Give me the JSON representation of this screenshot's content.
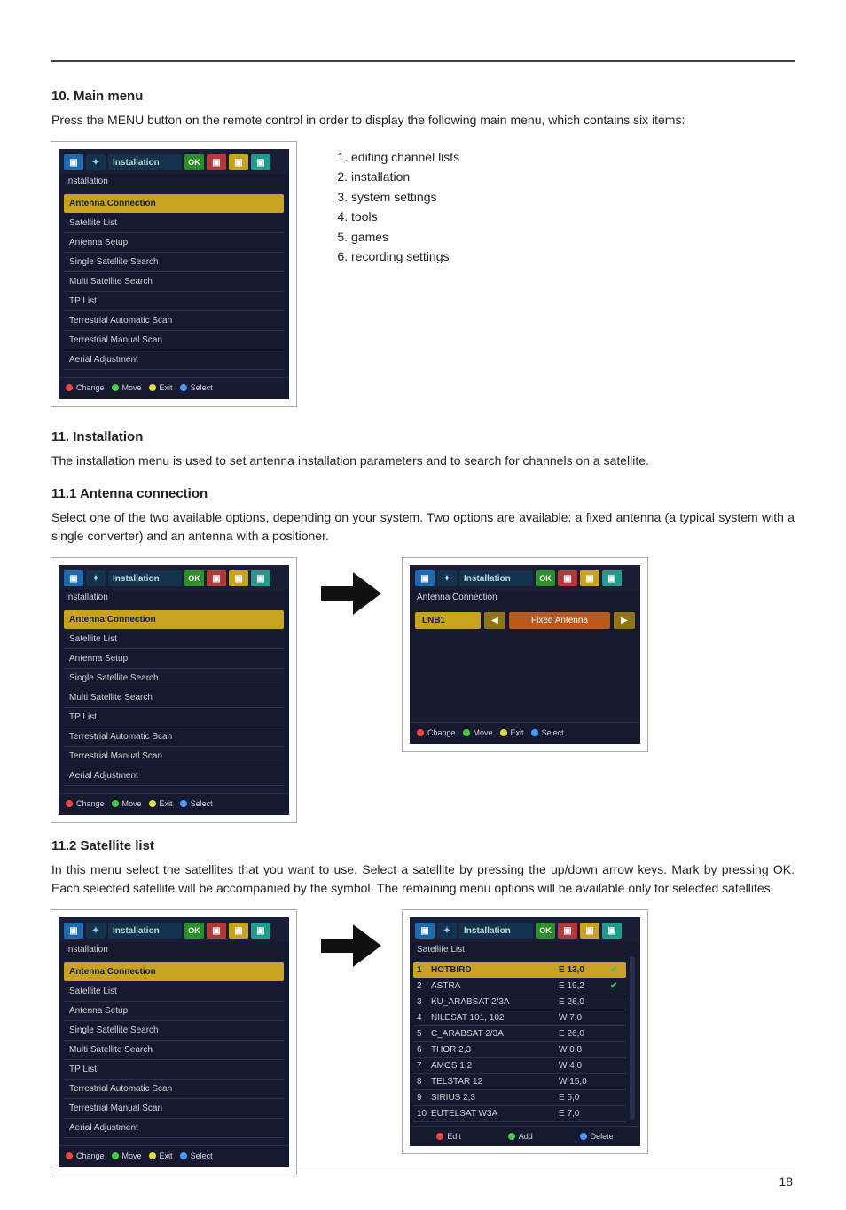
{
  "page_number": "18",
  "s10": {
    "heading": "10. Main menu",
    "para": "Press the MENU button on the remote control in order to display the following main menu, which contains six items:",
    "list": [
      "editing channel lists",
      "installation",
      "system settings",
      "tools",
      "games",
      "recording settings"
    ]
  },
  "s11": {
    "heading": "11. Installation",
    "para": "The installation menu is used to set antenna installation parameters and to search for channels on a satellite."
  },
  "s11_1": {
    "heading": "11.1 Antenna connection",
    "para": "Select one of the two available options, depending on your system. Two options are available: a fixed antenna (a typical system with a single converter) and an antenna with a positioner."
  },
  "s11_2": {
    "heading": "11.2 Satellite list",
    "para": "In this menu select the satellites that you want to use. Select a satellite by pressing the up/down arrow keys. Mark by pressing OK. Each selected satellite will be accompanied by the symbol. The remaining menu options will be available only for selected satellites."
  },
  "install_panel": {
    "tab_label": "Installation",
    "header": "Installation",
    "items": [
      "Antenna Connection",
      "Satellite List",
      "Antenna Setup",
      "Single Satellite Search",
      "Multi Satellite Search",
      "TP List",
      "Terrestrial Automatic Scan",
      "Terrestrial Manual Scan",
      "Aerial Adjustment"
    ],
    "footer": {
      "change": "Change",
      "move": "Move",
      "exit": "Exit",
      "select": "Select"
    }
  },
  "lnb_panel": {
    "tab_label": "Installation",
    "header": "Antenna Connection",
    "row": {
      "label": "LNB1",
      "value": "Fixed Antenna"
    },
    "footer": {
      "change": "Change",
      "move": "Move",
      "exit": "Exit",
      "select": "Select"
    }
  },
  "sat_panel": {
    "tab_label": "Installation",
    "header": "Satellite List",
    "rows": [
      {
        "idx": "1",
        "name": "HOTBIRD",
        "pos": "E 13,0",
        "mark": true
      },
      {
        "idx": "2",
        "name": "ASTRA",
        "pos": "E 19,2",
        "mark": true
      },
      {
        "idx": "3",
        "name": "KU_ARABSAT 2/3A",
        "pos": "E 26,0",
        "mark": false
      },
      {
        "idx": "4",
        "name": "NILESAT 101, 102",
        "pos": "W 7,0",
        "mark": false
      },
      {
        "idx": "5",
        "name": "C_ARABSAT 2/3A",
        "pos": "E 26,0",
        "mark": false
      },
      {
        "idx": "6",
        "name": "THOR 2,3",
        "pos": "W 0,8",
        "mark": false
      },
      {
        "idx": "7",
        "name": "AMOS 1,2",
        "pos": "W 4,0",
        "mark": false
      },
      {
        "idx": "8",
        "name": "TELSTAR 12",
        "pos": "W 15,0",
        "mark": false
      },
      {
        "idx": "9",
        "name": "SIRIUS 2,3",
        "pos": "E 5,0",
        "mark": false
      },
      {
        "idx": "10",
        "name": "EUTELSAT W3A",
        "pos": "E 7,0",
        "mark": false
      }
    ],
    "footer": {
      "edit": "Edit",
      "add": "Add",
      "delete": "Delete"
    }
  },
  "icons": {
    "ok": "OK",
    "circle": "●",
    "check": "✔"
  }
}
